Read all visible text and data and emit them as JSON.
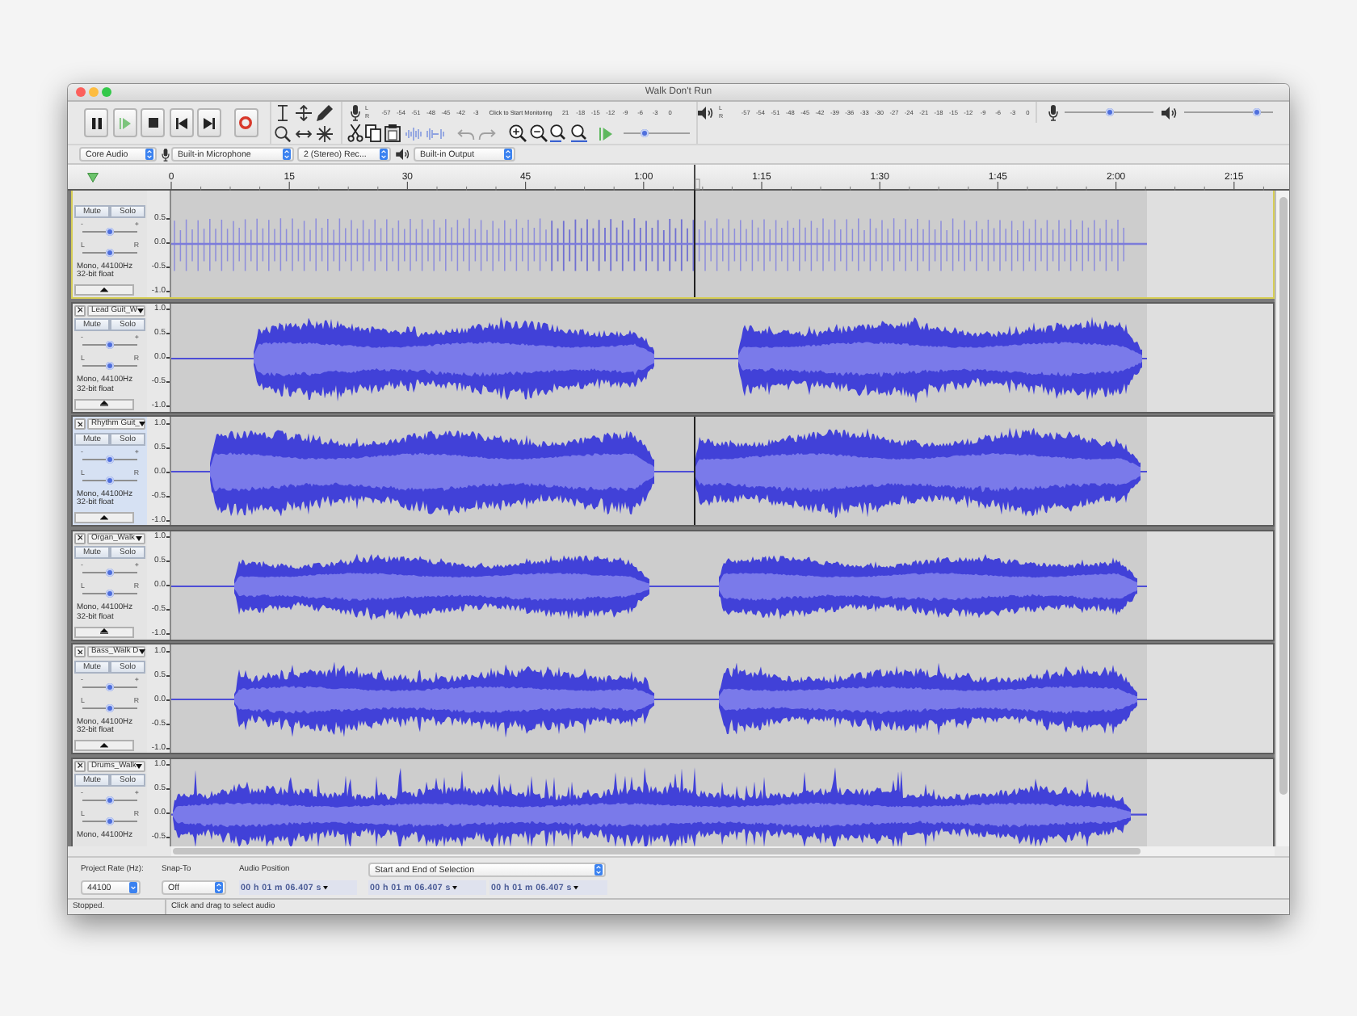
{
  "window": {
    "title": "Walk Don't Run"
  },
  "recording_meter": {
    "channels": [
      "L",
      "R"
    ],
    "labels_before": [
      "-57",
      "-54",
      "-51",
      "-48",
      "-45",
      "-42",
      "-3"
    ],
    "message": "Click to Start Monitoring",
    "labels_after": [
      "21",
      "-18",
      "-15",
      "-12",
      "-9",
      "-6",
      "-3",
      "0"
    ]
  },
  "play_at_speed": {
    "level": 0.32
  },
  "playback_meter": {
    "channels": [
      "L",
      "R"
    ],
    "labels": [
      "-57",
      "-54",
      "-51",
      "-48",
      "-45",
      "-42",
      "-39",
      "-36",
      "-33",
      "-30",
      "-27",
      "-24",
      "-21",
      "-18",
      "-15",
      "-12",
      "-9",
      "-6",
      "-3",
      "0"
    ]
  },
  "mixer": [
    {
      "kind": "input",
      "level": 0.51
    },
    {
      "kind": "output",
      "level": 0.82
    }
  ],
  "devices": [
    {
      "kind": "host",
      "value": "Core Audio"
    },
    {
      "kind": "input",
      "value": "Built-in Microphone"
    },
    {
      "kind": "channels",
      "value": "2 (Stereo) Rec..."
    },
    {
      "kind": "output",
      "value": "Built-in Output"
    }
  ],
  "timeline": {
    "labels": [
      "0",
      "15",
      "30",
      "45",
      "1:00",
      "1:15",
      "1:30",
      "1:45",
      "2:00",
      "2:15"
    ]
  },
  "tracks": [
    {
      "selected": false,
      "focused": true,
      "edit_cursor": true,
      "mute": "Mute",
      "solo": "Solo",
      "gain": {
        "labels": [
          "-",
          "+"
        ],
        "level": 0.5
      },
      "pan": {
        "labels": [
          "L",
          "R"
        ],
        "level": 0.5
      },
      "info": [
        "Mono, 44100Hz",
        "32-bit float"
      ],
      "scale": [
        "0.5",
        "0.0",
        "-0.5",
        "-1.0"
      ]
    },
    {
      "name": "Lead Guit_W",
      "selected": false,
      "focused": false,
      "edit_cursor": false,
      "mute": "Mute",
      "solo": "Solo",
      "gain": {
        "labels": [
          "-",
          "+"
        ],
        "level": 0.5
      },
      "pan": {
        "labels": [
          "L",
          "R"
        ],
        "level": 0.5
      },
      "info": [
        "Mono, 44100Hz",
        "32-bit float"
      ],
      "scale": [
        "1.0",
        "0.5",
        "0.0",
        "-0.5",
        "-1.0"
      ]
    },
    {
      "name": "Rhythm Guit_",
      "selected": true,
      "focused": false,
      "edit_cursor": true,
      "mute": "Mute",
      "solo": "Solo",
      "gain": {
        "labels": [
          "-",
          "+"
        ],
        "level": 0.5
      },
      "pan": {
        "labels": [
          "L",
          "R"
        ],
        "level": 0.5
      },
      "info": [
        "Mono, 44100Hz",
        "32-bit float"
      ],
      "scale": [
        "1.0",
        "0.5",
        "0.0",
        "-0.5",
        "-1.0"
      ]
    },
    {
      "name": "Organ_Walk",
      "selected": false,
      "focused": false,
      "edit_cursor": false,
      "mute": "Mute",
      "solo": "Solo",
      "gain": {
        "labels": [
          "-",
          "+"
        ],
        "level": 0.5
      },
      "pan": {
        "labels": [
          "L",
          "R"
        ],
        "level": 0.5
      },
      "info": [
        "Mono, 44100Hz",
        "32-bit float"
      ],
      "scale": [
        "1.0",
        "0.5",
        "0.0",
        "-0.5",
        "-1.0"
      ]
    },
    {
      "name": "Bass_Walk D",
      "selected": false,
      "focused": false,
      "edit_cursor": false,
      "mute": "Mute",
      "solo": "Solo",
      "gain": {
        "labels": [
          "-",
          "+"
        ],
        "level": 0.5
      },
      "pan": {
        "labels": [
          "L",
          "R"
        ],
        "level": 0.5
      },
      "info": [
        "Mono, 44100Hz",
        "32-bit float"
      ],
      "scale": [
        "1.0",
        "0.5",
        "0.0",
        "-0.5",
        "-1.0"
      ]
    },
    {
      "name": "Drums_Walk",
      "selected": false,
      "focused": false,
      "edit_cursor": false,
      "mute": "Mute",
      "solo": "Solo",
      "gain": {
        "labels": [
          "-",
          "+"
        ],
        "level": 0.5
      },
      "pan": {
        "labels": [
          "L",
          "R"
        ],
        "level": 0.5
      },
      "info": [
        "Mono, 44100Hz"
      ],
      "scale": [
        "1.0",
        "0.5",
        "0.0",
        "-0.5"
      ]
    }
  ],
  "selection_toolbar": {
    "project_rate": {
      "label": "Project Rate (Hz):",
      "value": "44100"
    },
    "snap_to": {
      "label": "Snap-To",
      "value": "Off"
    },
    "audio_position": {
      "label": "Audio Position",
      "value": "00 h 01 m 06.407 s"
    },
    "selection": {
      "mode": "Start and End of Selection",
      "start": "00 h 01 m 06.407 s",
      "end": "00 h 01 m 06.407 s"
    }
  },
  "status_bar": {
    "state": "Stopped.",
    "hint": "Click and drag to select audio"
  }
}
